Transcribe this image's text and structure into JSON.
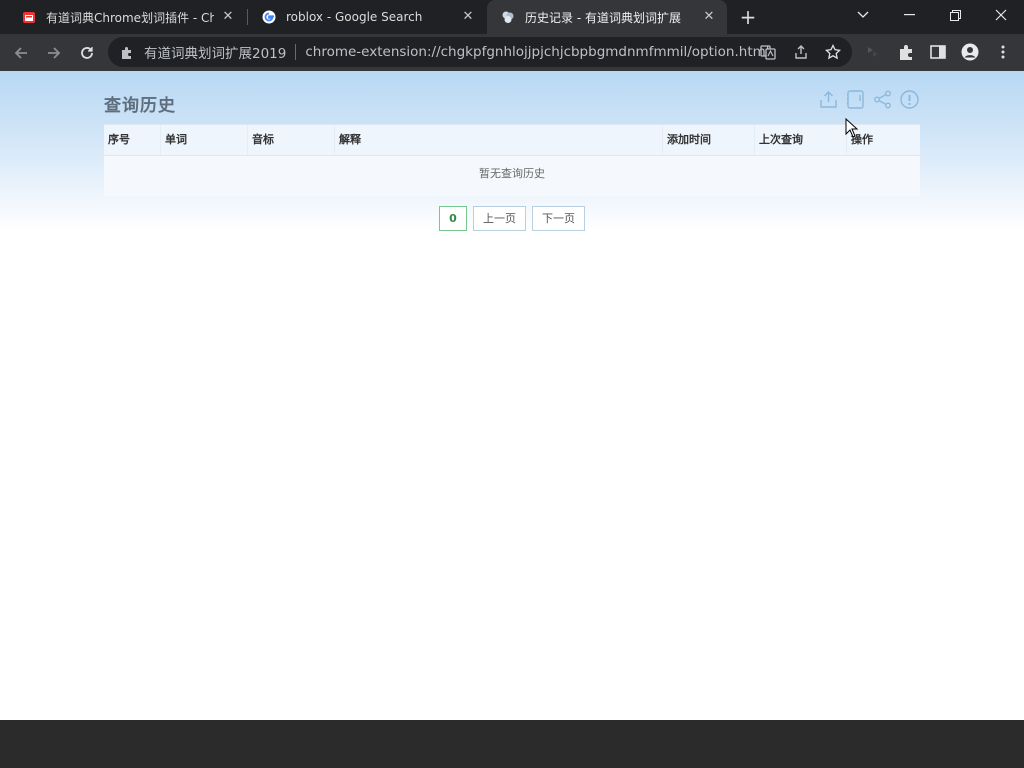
{
  "tabs": [
    {
      "title": "有道词典Chrome划词插件 - Chro",
      "favicon": "youdao-favicon"
    },
    {
      "title": "roblox - Google Search",
      "favicon": "google-favicon"
    },
    {
      "title": "历史记录 - 有道词典划词扩展",
      "favicon": "extension-puzzle-favicon"
    }
  ],
  "omnibox": {
    "site_name": "有道词典划词扩展2019",
    "url": "chrome-extension://chgkpfgnhlojjpjchjcbpbgmdnmfmmil/option.html"
  },
  "page": {
    "title": "查询历史",
    "table": {
      "columns": [
        "序号",
        "单词",
        "音标",
        "解释",
        "添加时间",
        "上次查询",
        "操作"
      ],
      "empty_text": "暂无查询历史"
    },
    "pager": {
      "current_page": "0",
      "prev_label": "上一页",
      "next_label": "下一页"
    }
  },
  "colors": {
    "tabstrip": "#202124",
    "toolbar": "#35363a",
    "title_text": "#5f6e7e",
    "icon_blue": "#8ab8dc",
    "pager_green": "#78c78f"
  }
}
